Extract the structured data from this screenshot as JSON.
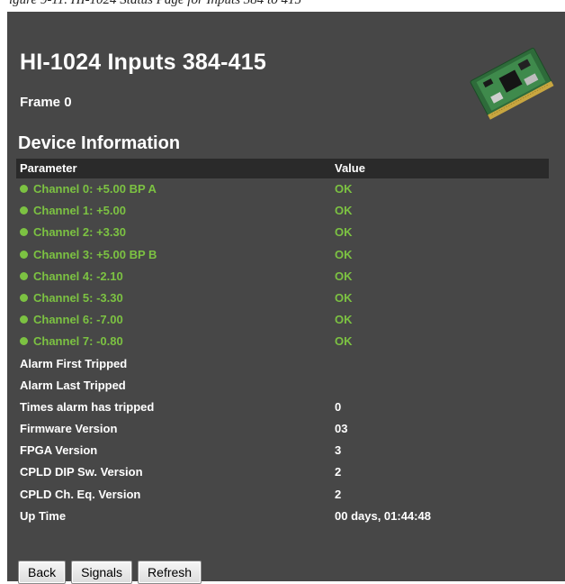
{
  "page": {
    "caption": "igure 9-11. HI-1024 Status Page for Inputs 384 to 415",
    "title": "HI-1024 Inputs 384-415",
    "frame": "Frame 0",
    "section": "Device Information"
  },
  "table": {
    "headers": {
      "parameter": "Parameter",
      "value": "Value"
    },
    "channels": [
      {
        "name": "Channel 0: +5.00 BP A",
        "value": "OK"
      },
      {
        "name": "Channel 1: +5.00",
        "value": "OK"
      },
      {
        "name": "Channel 2: +3.30",
        "value": "OK"
      },
      {
        "name": "Channel 3: +5.00 BP B",
        "value": "OK"
      },
      {
        "name": "Channel 4: -2.10",
        "value": "OK"
      },
      {
        "name": "Channel 5: -3.30",
        "value": "OK"
      },
      {
        "name": "Channel 6: -7.00",
        "value": "OK"
      },
      {
        "name": "Channel 7: -0.80",
        "value": "OK"
      }
    ],
    "info": [
      {
        "name": "Alarm First Tripped",
        "value": ""
      },
      {
        "name": "Alarm Last Tripped",
        "value": ""
      },
      {
        "name": "Times alarm has tripped",
        "value": "0"
      },
      {
        "name": "Firmware Version",
        "value": "03"
      },
      {
        "name": "FPGA Version",
        "value": "3"
      },
      {
        "name": "CPLD DIP Sw. Version",
        "value": "2"
      },
      {
        "name": "CPLD Ch. Eq. Version",
        "value": "2"
      },
      {
        "name": "Up Time",
        "value": "00 days, 01:44:48"
      }
    ]
  },
  "buttons": {
    "back": "Back",
    "signals": "Signals",
    "refresh": "Refresh"
  },
  "colors": {
    "panel": "#474747",
    "header": "#2a2a2a",
    "status_ok": "#7cc242",
    "text": "#ffffff"
  },
  "icons": {
    "board": "circuit-board-icon",
    "status": "status-dot-icon"
  }
}
